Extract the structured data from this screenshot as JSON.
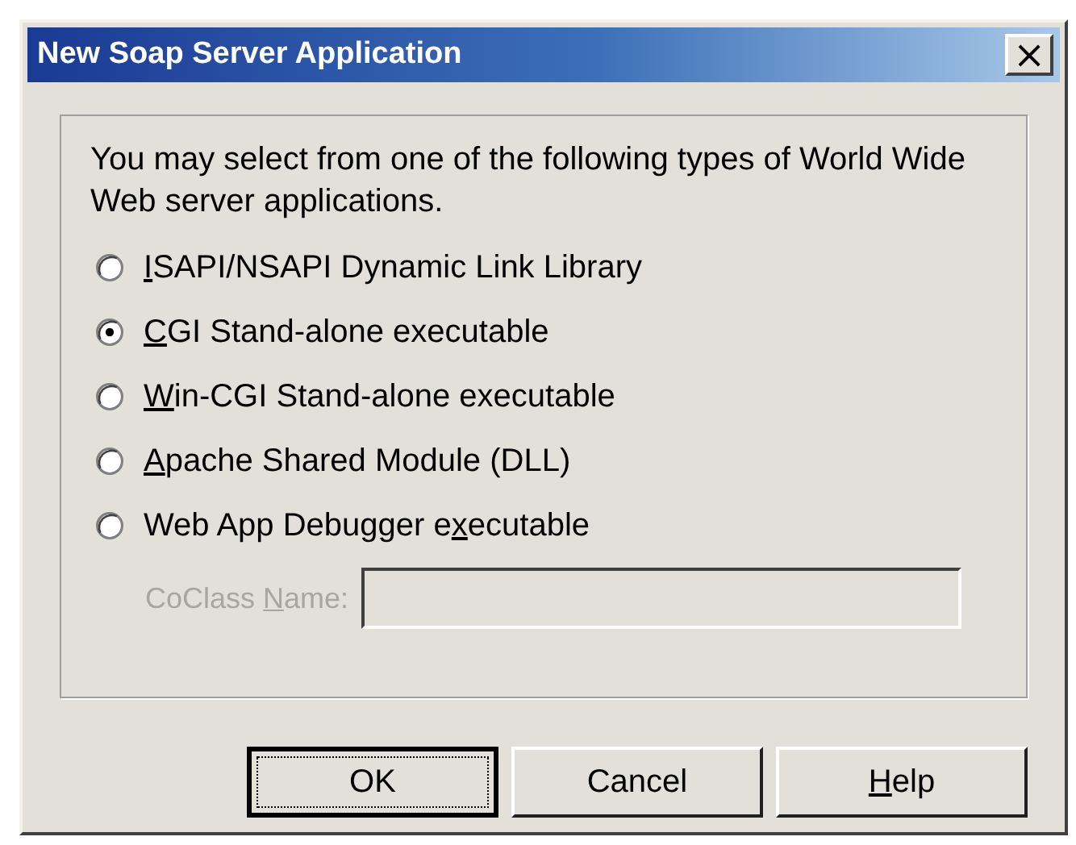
{
  "window": {
    "title": "New Soap Server Application",
    "close_button": "×"
  },
  "intro": "You may select from one of the following types of World Wide Web server applications.",
  "options": [
    {
      "label": {
        "key": "I",
        "after": "SAPI/NSAPI Dynamic Link Library"
      },
      "selected": false
    },
    {
      "label": {
        "key": "C",
        "after": "GI Stand-alone executable"
      },
      "selected": true
    },
    {
      "label": {
        "key": "W",
        "after": "in-CGI Stand-alone executable"
      },
      "selected": false
    },
    {
      "label": {
        "key": "A",
        "after": "pache Shared Module (DLL)"
      },
      "selected": false
    },
    {
      "label": {
        "before": "Web App Debugger e",
        "key": "x",
        "after": "ecutable"
      },
      "selected": false
    }
  ],
  "coclass": {
    "label": {
      "before": "CoClass ",
      "key": "N",
      "after": "ame:"
    },
    "disabled": true
  },
  "buttons": [
    {
      "label": {
        "before": "OK"
      },
      "default": true
    },
    {
      "label": {
        "before": "Cancel"
      },
      "default": false
    },
    {
      "label": {
        "key": "H",
        "after": "elp"
      },
      "default": false
    }
  ]
}
